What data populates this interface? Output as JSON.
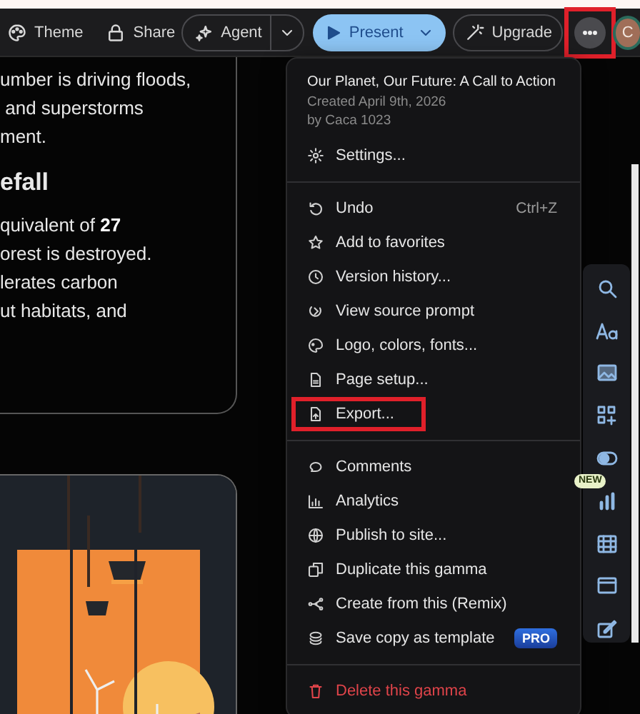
{
  "toolbar": {
    "theme": {
      "label": "Theme"
    },
    "share": {
      "label": "Share"
    },
    "agent": {
      "label": "Agent"
    },
    "present": {
      "label": "Present"
    },
    "upgrade": {
      "label": "Upgrade"
    },
    "more": {
      "highlighted": true
    },
    "avatar": {
      "initial": "C"
    }
  },
  "slide_card": {
    "lines": [
      {
        "kind": "text",
        "text": "umber is driving floods,"
      },
      {
        "kind": "text",
        "text": " and superstorms"
      },
      {
        "kind": "text",
        "text": "ment."
      },
      {
        "kind": "heading",
        "text": "efall"
      },
      {
        "kind": "text",
        "text": "quivalent of **27**"
      },
      {
        "kind": "text",
        "text": "orest is destroyed."
      },
      {
        "kind": "text",
        "text": "lerates carbon"
      },
      {
        "kind": "text",
        "text": "ut habitats, and"
      }
    ]
  },
  "menu": {
    "title": "Our Planet, Our Future: A Call to Action",
    "created": "Created April 9th, 2026",
    "author": "by Caca 1023",
    "groups": [
      [
        {
          "kind": "item",
          "label": "Settings...",
          "highlighted": false
        }
      ],
      [
        {
          "kind": "item",
          "label": "Undo",
          "shortcut": "Ctrl+Z",
          "highlighted": false
        },
        {
          "kind": "item",
          "label": "Add to favorites",
          "highlighted": false
        },
        {
          "kind": "item",
          "label": "Version history...",
          "highlighted": false
        },
        {
          "kind": "item",
          "label": "View source prompt",
          "highlighted": false
        },
        {
          "kind": "item",
          "label": "Logo, colors, fonts...",
          "highlighted": false
        },
        {
          "kind": "item",
          "label": "Page setup...",
          "highlighted": false
        },
        {
          "kind": "item",
          "label": "Export...",
          "highlighted": true
        }
      ],
      [
        {
          "kind": "item",
          "label": "Comments",
          "highlighted": false
        },
        {
          "kind": "item",
          "label": "Analytics",
          "highlighted": false
        },
        {
          "kind": "item",
          "label": "Publish to site...",
          "highlighted": false
        },
        {
          "kind": "item",
          "label": "Duplicate this gamma",
          "highlighted": false
        },
        {
          "kind": "item",
          "label": "Create from this (Remix)",
          "highlighted": false
        },
        {
          "kind": "item",
          "label": "Save copy as template",
          "badge": "PRO",
          "highlighted": false
        }
      ],
      [
        {
          "kind": "danger",
          "label": "Delete this gamma",
          "highlighted": false
        }
      ]
    ]
  },
  "side_tools": {
    "badge": "NEW"
  }
}
